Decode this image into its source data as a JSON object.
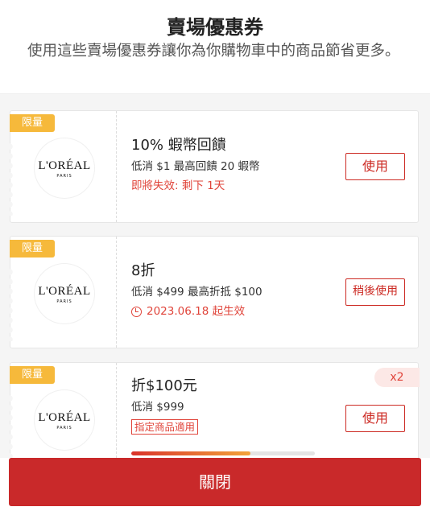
{
  "header": {
    "title": "賣場優惠券",
    "subtitle": "使用這些賣場優惠券讓你為你購物車中的商品節省更多。"
  },
  "vouchers": [
    {
      "tag": "限量",
      "brand": "L'ORÉAL",
      "brand_sub": "PARIS",
      "name": "10% 蝦幣回饋",
      "condition": "低消 $1 最高回饋 20 蝦幣",
      "status": "即將失效: 剩下 1天",
      "button": "使用"
    },
    {
      "tag": "限量",
      "brand": "L'ORÉAL",
      "brand_sub": "PARIS",
      "name": "8折",
      "condition": "低消 $499 最高折抵 $100",
      "status": "2023.06.18 起生效",
      "button": "稍後使用"
    },
    {
      "tag": "限量",
      "brand": "L'ORÉAL",
      "brand_sub": "PARIS",
      "name": "折$100元",
      "condition": "低消 $999",
      "badge": "指定商品適用",
      "count": "x2",
      "progress": 0.65,
      "button": "使用"
    }
  ],
  "footer": {
    "close_label": "關閉"
  },
  "colors": {
    "accent": "#c9292a",
    "tag": "#f6b93b",
    "status": "#e0443a"
  }
}
